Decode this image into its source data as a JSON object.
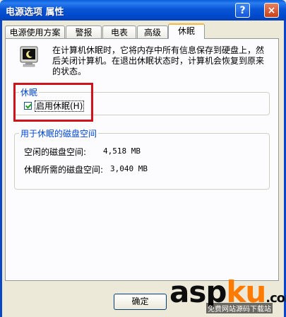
{
  "window": {
    "title": "电源选项 属性",
    "help_glyph": "?",
    "close_glyph": "×"
  },
  "tabs": [
    {
      "label": "电源使用方案"
    },
    {
      "label": "警报"
    },
    {
      "label": "电表"
    },
    {
      "label": "高级"
    },
    {
      "label": "休眠",
      "active": true
    }
  ],
  "hibernate": {
    "description": "在计算机休眠时，它将内存中所有信息保存到硬盘上，然后关闭计算机。在退出休眠状态时，计算机会恢复到原来的状态。",
    "group_title": "休眠",
    "enable_label": "启用休眠(H)",
    "enable_checked": true
  },
  "disk_space": {
    "group_title": "用于休眠的磁盘空间",
    "free_label": "空闲的磁盘空间:",
    "free_value": "4,518 MB",
    "required_label": "休眠所需的磁盘空间:",
    "required_value": "3,040 MB"
  },
  "buttons": {
    "ok": "确定"
  },
  "watermark": {
    "brand_asp": "asp",
    "brand_ku": "ku",
    "brand_dot": ".com",
    "sub": "免费网站源码下载站"
  },
  "colors": {
    "title_bar": "#0855d6",
    "group_title": "#0046d5",
    "highlight_box": "#d0121a",
    "active_tab_top": "#f5b841"
  }
}
